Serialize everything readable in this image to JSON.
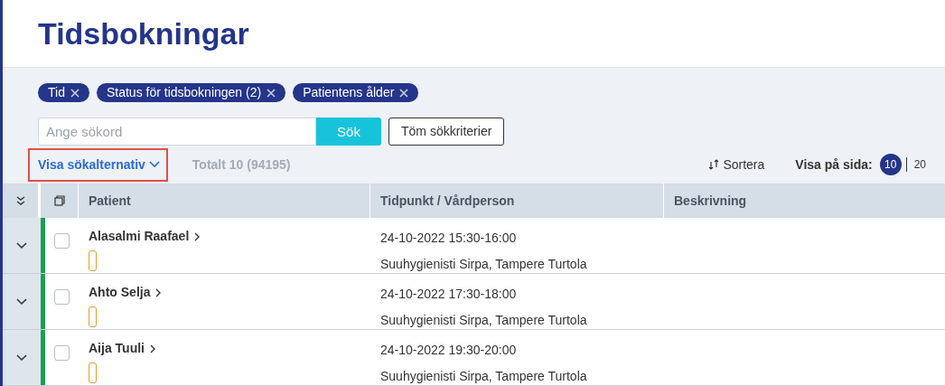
{
  "title": "Tidsbokningar",
  "filters": [
    {
      "label": "Tid"
    },
    {
      "label": "Status för tidsbokningen (2)"
    },
    {
      "label": "Patientens ålder"
    }
  ],
  "search": {
    "placeholder": "Ange sökord",
    "button": "Sök",
    "clear": "Töm sökkriterier"
  },
  "options_link": {
    "label": "Visa sökalternativ",
    "highlighted": true
  },
  "total": "Totalt 10 (94195)",
  "sort": "Sortera",
  "per_page": {
    "label": "Visa på sida:",
    "options": [
      {
        "label": "10",
        "selected": true
      },
      {
        "label": "20",
        "selected": false
      }
    ]
  },
  "table": {
    "columns": [
      "Patient",
      "Tidpunkt / Vårdperson",
      "Beskrivning"
    ],
    "rows": [
      {
        "patient": "Alasalmi Raafael",
        "time": "24-10-2022 15:30-16:00",
        "staff": "Suuhygienisti Sirpa, Tampere Turtola",
        "color": "#1aa052",
        "checked": false
      },
      {
        "patient": "Ahto Selja",
        "time": "24-10-2022 17:30-18:00",
        "staff": "Suuhygienisti Sirpa, Tampere Turtola",
        "color": "#1aa052",
        "checked": false
      },
      {
        "patient": "Aija Tuuli",
        "time": "24-10-2022 19:30-20:00",
        "staff": "Suuhygienisti Sirpa, Tampere Turtola",
        "color": "#1aa052",
        "checked": false
      }
    ]
  }
}
